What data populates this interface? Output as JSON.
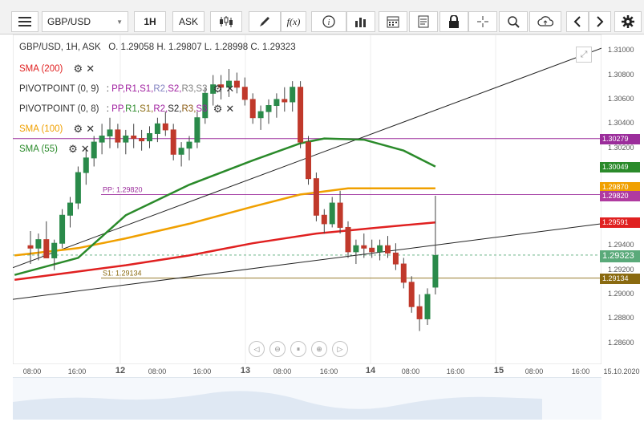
{
  "toolbar": {
    "symbol": "GBP/USD",
    "timeframe": "1H",
    "price_type": "ASK",
    "fx_label": "f(x)"
  },
  "header": {
    "instrument_line": "GBP/USD, 1H, ASK",
    "ohlc": "O. 1.29058 H. 1.29807 L. 1.28998 C. 1.29323"
  },
  "indicators": {
    "sma200": {
      "name": "SMA (200)",
      "color": "#e02020"
    },
    "pivot1": {
      "name": "PIVOTPOINT (0, 9)",
      "sep": ":",
      "items": [
        "PP,",
        "R1,",
        "S1,",
        "R2,",
        "S2,",
        "R3,",
        "S3"
      ],
      "colors": [
        "#a020a0",
        "#a020a0",
        "#a020a0",
        "#8080c0",
        "#a020a0",
        "#808080",
        "#808080"
      ]
    },
    "pivot2": {
      "name": "PIVOTPOINT (0, 8)",
      "sep": ":",
      "items": [
        "PP,",
        "R1,",
        "S1,",
        "R2,",
        "S2,",
        "R3,",
        "S3"
      ],
      "colors": [
        "#a020a0",
        "#2a8a2a",
        "#8a6a10",
        "#a020a0",
        "#222222",
        "#8a5a10",
        "#a020a0"
      ]
    },
    "sma100": {
      "name": "SMA (100)",
      "color": "#f0a000"
    },
    "sma55": {
      "name": "SMA (55)",
      "color": "#2a8a2a"
    }
  },
  "line_labels": {
    "pp": "PP: 1.29820",
    "s1": "S1: 1.29134"
  },
  "price_axis": [
    "1.31000",
    "1.30800",
    "1.30600",
    "1.30400",
    "1.30200",
    "1.29400",
    "1.29200",
    "1.29000",
    "1.28800",
    "1.28600"
  ],
  "price_labels": [
    {
      "text": "1.30279",
      "color": "#9b2d9b"
    },
    {
      "text": "1.30049",
      "color": "#2a8a2a"
    },
    {
      "text": "1.29870",
      "color": "#f0a000"
    },
    {
      "text": "1.29820",
      "color": "#b03aa0"
    },
    {
      "text": "1.29591",
      "color": "#e02020"
    },
    {
      "text": "1.29323",
      "color": "#5aaa7a"
    },
    {
      "text": "1.29134",
      "color": "#8a6a10"
    }
  ],
  "time_axis": [
    {
      "text": "08:00",
      "bold": false
    },
    {
      "text": "16:00",
      "bold": false
    },
    {
      "text": "12",
      "bold": true
    },
    {
      "text": "08:00",
      "bold": false
    },
    {
      "text": "16:00",
      "bold": false
    },
    {
      "text": "13",
      "bold": true
    },
    {
      "text": "08:00",
      "bold": false
    },
    {
      "text": "16:00",
      "bold": false
    },
    {
      "text": "14",
      "bold": true
    },
    {
      "text": "08:00",
      "bold": false
    },
    {
      "text": "16:00",
      "bold": false
    },
    {
      "text": "15",
      "bold": true
    },
    {
      "text": "08:00",
      "bold": false
    },
    {
      "text": "16:00",
      "bold": false
    },
    {
      "text": "15.10.2020",
      "bold": false
    }
  ],
  "colors": {
    "bull": "#2a8a4a",
    "bear": "#c0392b",
    "sma200": "#e02020",
    "sma100": "#f0a000",
    "sma55": "#2a8a2a",
    "pivot": "#9b2d9b",
    "s1": "#8a6a10",
    "trend": "#222222",
    "current": "#5aaa7a"
  },
  "icons": [
    "menu-icon",
    "candles-icon",
    "pencil-icon",
    "info-icon",
    "bar-chart-icon",
    "calendar-icon",
    "notes-icon",
    "lock-icon",
    "crosshair-icon",
    "zoom-icon",
    "cloud-upload-icon",
    "chevron-left-icon",
    "chevron-right-icon",
    "gear-icon",
    "expand-icon"
  ],
  "chart_data": {
    "type": "candlestick",
    "symbol": "GBP/USD",
    "interval": "1H",
    "ylim": [
      1.285,
      1.3108
    ],
    "candles": [
      [
        1.294,
        1.2952,
        1.2925,
        1.2938
      ],
      [
        1.2938,
        1.295,
        1.2928,
        1.2945
      ],
      [
        1.2945,
        1.296,
        1.2935,
        1.293
      ],
      [
        1.293,
        1.2945,
        1.292,
        1.2942
      ],
      [
        1.2942,
        1.297,
        1.2938,
        1.2965
      ],
      [
        1.2965,
        1.298,
        1.2955,
        1.2975
      ],
      [
        1.2975,
        1.3005,
        1.297,
        1.3
      ],
      [
        1.3,
        1.302,
        1.299,
        1.3012
      ],
      [
        1.3012,
        1.303,
        1.3005,
        1.3025
      ],
      [
        1.3025,
        1.304,
        1.3015,
        1.303
      ],
      [
        1.303,
        1.3045,
        1.302,
        1.3035
      ],
      [
        1.3035,
        1.304,
        1.302,
        1.3025
      ],
      [
        1.3025,
        1.3035,
        1.3015,
        1.303
      ],
      [
        1.303,
        1.304,
        1.302,
        1.3028
      ],
      [
        1.3028,
        1.3035,
        1.3018,
        1.3026
      ],
      [
        1.3026,
        1.3038,
        1.302,
        1.3032
      ],
      [
        1.3032,
        1.3045,
        1.3025,
        1.304
      ],
      [
        1.304,
        1.305,
        1.303,
        1.3035
      ],
      [
        1.3035,
        1.304,
        1.301,
        1.3015
      ],
      [
        1.3015,
        1.3025,
        1.3005,
        1.302
      ],
      [
        1.302,
        1.303,
        1.301,
        1.3025
      ],
      [
        1.3025,
        1.305,
        1.302,
        1.3045
      ],
      [
        1.3045,
        1.307,
        1.304,
        1.3065
      ],
      [
        1.3065,
        1.308,
        1.3055,
        1.3072
      ],
      [
        1.3072,
        1.308,
        1.306,
        1.307
      ],
      [
        1.307,
        1.3085,
        1.3062,
        1.3075
      ],
      [
        1.3075,
        1.3082,
        1.3065,
        1.307
      ],
      [
        1.307,
        1.3078,
        1.3055,
        1.306
      ],
      [
        1.306,
        1.3065,
        1.304,
        1.3045
      ],
      [
        1.3045,
        1.3055,
        1.3035,
        1.305
      ],
      [
        1.305,
        1.306,
        1.304,
        1.3055
      ],
      [
        1.3055,
        1.3065,
        1.3045,
        1.306
      ],
      [
        1.306,
        1.307,
        1.305,
        1.3058
      ],
      [
        1.3058,
        1.3075,
        1.305,
        1.307
      ],
      [
        1.307,
        1.3075,
        1.302,
        1.3025
      ],
      [
        1.3025,
        1.303,
        1.299,
        1.2995
      ],
      [
        1.2995,
        1.3,
        1.296,
        1.2965
      ],
      [
        1.2965,
        1.297,
        1.295,
        1.2958
      ],
      [
        1.2958,
        1.298,
        1.2955,
        1.2975
      ],
      [
        1.2975,
        1.2985,
        1.295,
        1.2955
      ],
      [
        1.2955,
        1.296,
        1.293,
        1.2935
      ],
      [
        1.2935,
        1.2945,
        1.2925,
        1.294
      ],
      [
        1.294,
        1.295,
        1.293,
        1.2938
      ],
      [
        1.2938,
        1.2945,
        1.293,
        1.2935
      ],
      [
        1.2935,
        1.2945,
        1.2928,
        1.294
      ],
      [
        1.294,
        1.2948,
        1.293,
        1.2934
      ],
      [
        1.2934,
        1.2942,
        1.292,
        1.2925
      ],
      [
        1.2925,
        1.293,
        1.2905,
        1.291
      ],
      [
        1.291,
        1.2915,
        1.2885,
        1.289
      ],
      [
        1.289,
        1.29,
        1.287,
        1.288
      ],
      [
        1.288,
        1.2905,
        1.2875,
        1.29
      ],
      [
        1.2906,
        1.2981,
        1.29,
        1.2932
      ]
    ],
    "sma200_end": 1.29591,
    "sma100_end": 1.2987,
    "sma55_end": 1.30049,
    "pp": 1.2982,
    "s1": 1.29134,
    "r_level": 1.30279,
    "last_close": 1.29323
  }
}
